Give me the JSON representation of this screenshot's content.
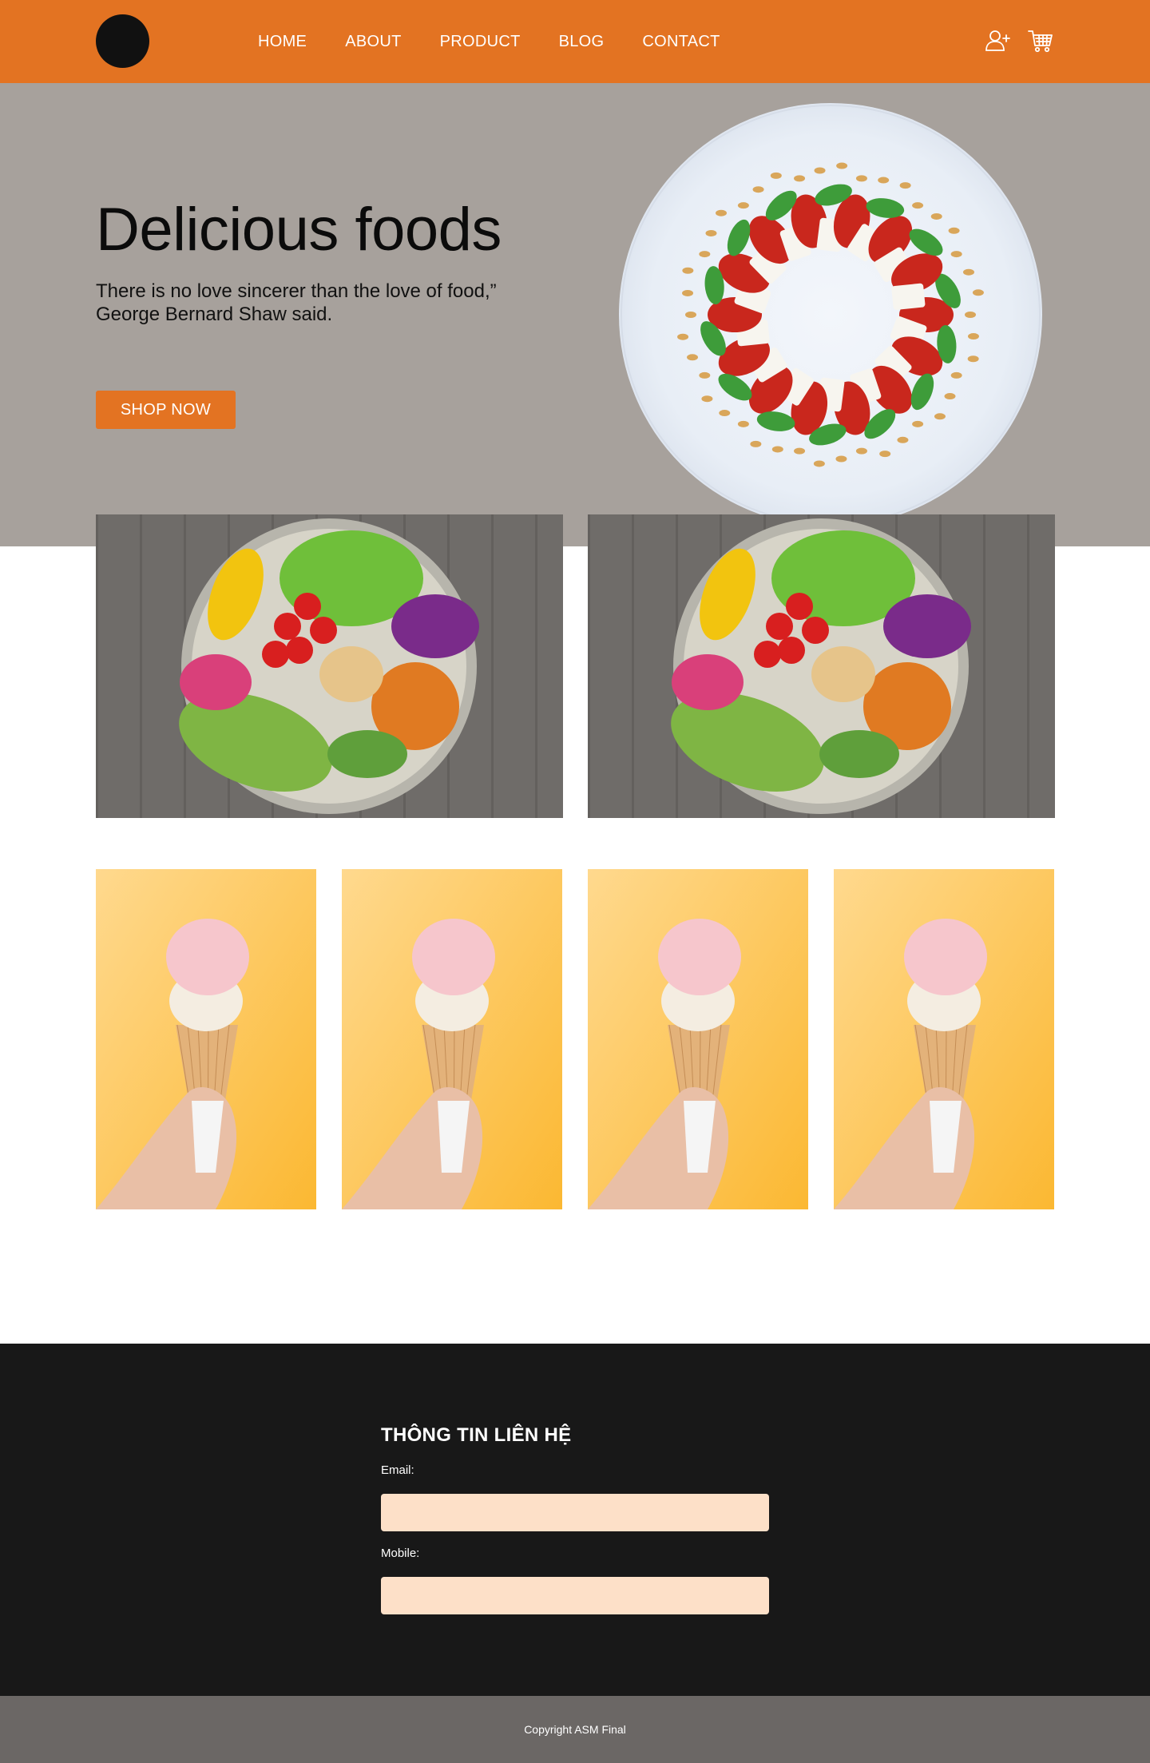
{
  "header": {
    "nav": [
      "HOME",
      "ABOUT",
      "PRODUCT",
      "BLOG",
      "CONTACT"
    ],
    "icons": [
      "user-plus-icon",
      "cart-icon"
    ]
  },
  "hero": {
    "title": "Delicious foods",
    "quote_line1": "There is no love sincerer than the love of food,”",
    "quote_line2": "George Bernard Shaw said.",
    "cta": "SHOP NOW"
  },
  "contact": {
    "title": "THÔNG TIN LIÊN HỆ",
    "email_label": "Email:",
    "email_value": "",
    "mobile_label": "Mobile:",
    "mobile_value": ""
  },
  "footer": {
    "copyright": "Copyright ASM Final"
  },
  "colors": {
    "brand_orange": "#e37322",
    "hero_bg": "#a7a19c",
    "contact_bg": "#181818",
    "input_bg": "#fde0c8",
    "footer_bg": "#6b6765"
  }
}
